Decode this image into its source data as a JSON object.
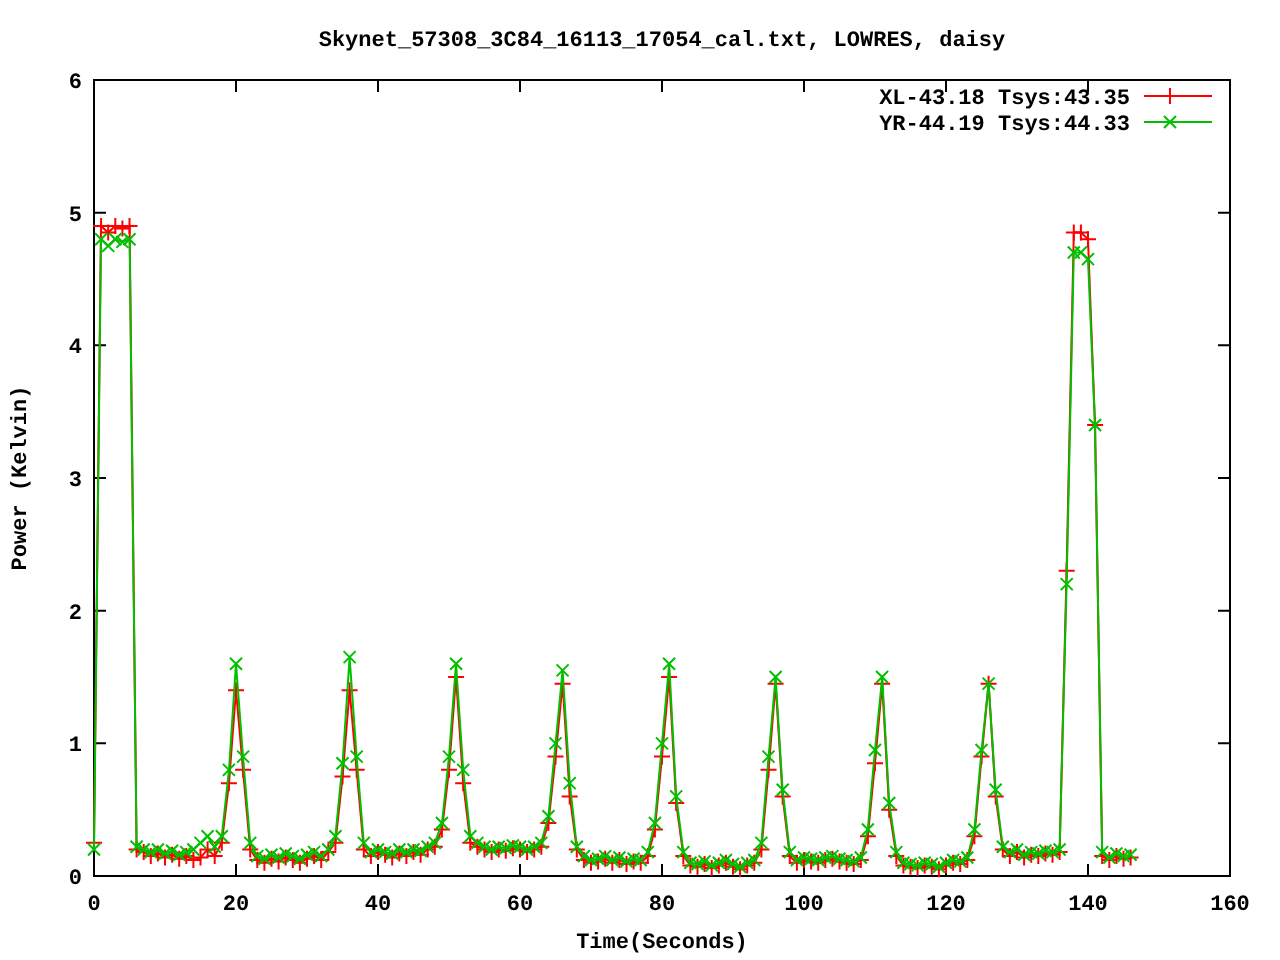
{
  "chart_data": {
    "type": "line",
    "title": "Skynet_57308_3C84_16113_17054_cal.txt, LOWRES, daisy",
    "xlabel": "Time(Seconds)",
    "ylabel": "Power (Kelvin)",
    "xlim": [
      0,
      160
    ],
    "ylim": [
      0,
      6
    ],
    "xticks": [
      0,
      20,
      40,
      60,
      80,
      100,
      120,
      140,
      160
    ],
    "yticks": [
      0,
      1,
      2,
      3,
      4,
      5,
      6
    ],
    "legend": true,
    "x": [
      0,
      1,
      2,
      3,
      4,
      5,
      6,
      7,
      8,
      9,
      10,
      11,
      12,
      13,
      14,
      15,
      16,
      17,
      18,
      19,
      20,
      21,
      22,
      23,
      24,
      25,
      26,
      27,
      28,
      29,
      30,
      31,
      32,
      33,
      34,
      35,
      36,
      37,
      38,
      39,
      40,
      41,
      42,
      43,
      44,
      45,
      46,
      47,
      48,
      49,
      50,
      51,
      52,
      53,
      54,
      55,
      56,
      57,
      58,
      59,
      60,
      61,
      62,
      63,
      64,
      65,
      66,
      67,
      68,
      69,
      70,
      71,
      72,
      73,
      74,
      75,
      76,
      77,
      78,
      79,
      80,
      81,
      82,
      83,
      84,
      85,
      86,
      87,
      88,
      89,
      90,
      91,
      92,
      93,
      94,
      95,
      96,
      97,
      98,
      99,
      100,
      101,
      102,
      103,
      104,
      105,
      106,
      107,
      108,
      109,
      110,
      111,
      112,
      113,
      114,
      115,
      116,
      117,
      118,
      119,
      120,
      121,
      122,
      123,
      124,
      125,
      126,
      127,
      128,
      129,
      130,
      131,
      132,
      133,
      134,
      135,
      136,
      137,
      138,
      139,
      140,
      141,
      142,
      143,
      144,
      145,
      146
    ],
    "series": [
      {
        "name": "XL-43.18 Tsys:43.35",
        "color": "#ff0000",
        "marker": "plus",
        "values": [
          0.25,
          4.9,
          4.85,
          4.9,
          4.88,
          4.9,
          0.2,
          0.18,
          0.15,
          0.17,
          0.14,
          0.16,
          0.13,
          0.15,
          0.12,
          0.14,
          0.2,
          0.15,
          0.25,
          0.7,
          1.4,
          0.8,
          0.2,
          0.12,
          0.1,
          0.13,
          0.11,
          0.14,
          0.12,
          0.1,
          0.13,
          0.15,
          0.12,
          0.18,
          0.25,
          0.75,
          1.4,
          0.8,
          0.2,
          0.15,
          0.18,
          0.16,
          0.14,
          0.17,
          0.15,
          0.18,
          0.16,
          0.2,
          0.22,
          0.35,
          0.8,
          1.5,
          0.7,
          0.25,
          0.22,
          0.2,
          0.18,
          0.2,
          0.19,
          0.21,
          0.2,
          0.18,
          0.2,
          0.22,
          0.4,
          0.9,
          1.45,
          0.6,
          0.2,
          0.12,
          0.1,
          0.11,
          0.13,
          0.1,
          0.12,
          0.09,
          0.11,
          0.1,
          0.15,
          0.35,
          0.9,
          1.5,
          0.55,
          0.15,
          0.08,
          0.07,
          0.09,
          0.06,
          0.08,
          0.1,
          0.07,
          0.05,
          0.08,
          0.1,
          0.2,
          0.8,
          1.45,
          0.6,
          0.15,
          0.1,
          0.12,
          0.11,
          0.1,
          0.12,
          0.13,
          0.11,
          0.1,
          0.09,
          0.12,
          0.3,
          0.85,
          1.45,
          0.5,
          0.15,
          0.08,
          0.07,
          0.06,
          0.08,
          0.07,
          0.05,
          0.08,
          0.1,
          0.09,
          0.12,
          0.3,
          0.9,
          1.45,
          0.6,
          0.2,
          0.15,
          0.18,
          0.14,
          0.16,
          0.15,
          0.17,
          0.16,
          0.18,
          2.3,
          4.85,
          4.85,
          4.8,
          3.4,
          0.15,
          0.12,
          0.15,
          0.13,
          0.14
        ]
      },
      {
        "name": "YR-44.19 Tsys:44.33",
        "color": "#00c000",
        "marker": "cross",
        "values": [
          0.2,
          4.8,
          4.75,
          4.8,
          4.78,
          4.8,
          0.22,
          0.2,
          0.18,
          0.2,
          0.17,
          0.19,
          0.16,
          0.18,
          0.2,
          0.25,
          0.3,
          0.22,
          0.3,
          0.8,
          1.6,
          0.9,
          0.25,
          0.15,
          0.13,
          0.16,
          0.14,
          0.17,
          0.15,
          0.13,
          0.16,
          0.18,
          0.15,
          0.2,
          0.3,
          0.85,
          1.65,
          0.9,
          0.25,
          0.18,
          0.2,
          0.18,
          0.17,
          0.2,
          0.18,
          0.2,
          0.19,
          0.22,
          0.25,
          0.4,
          0.9,
          1.6,
          0.8,
          0.3,
          0.25,
          0.22,
          0.2,
          0.22,
          0.21,
          0.23,
          0.22,
          0.2,
          0.22,
          0.25,
          0.45,
          1.0,
          1.55,
          0.7,
          0.22,
          0.15,
          0.12,
          0.13,
          0.15,
          0.12,
          0.14,
          0.11,
          0.13,
          0.12,
          0.18,
          0.4,
          1.0,
          1.6,
          0.6,
          0.18,
          0.1,
          0.09,
          0.11,
          0.08,
          0.1,
          0.12,
          0.09,
          0.07,
          0.1,
          0.12,
          0.25,
          0.9,
          1.5,
          0.65,
          0.18,
          0.12,
          0.14,
          0.13,
          0.12,
          0.14,
          0.15,
          0.13,
          0.12,
          0.11,
          0.14,
          0.35,
          0.95,
          1.5,
          0.55,
          0.18,
          0.1,
          0.09,
          0.08,
          0.1,
          0.09,
          0.07,
          0.1,
          0.12,
          0.11,
          0.14,
          0.35,
          0.95,
          1.45,
          0.65,
          0.22,
          0.18,
          0.2,
          0.16,
          0.18,
          0.17,
          0.19,
          0.18,
          0.2,
          2.2,
          4.7,
          4.7,
          4.65,
          3.4,
          0.18,
          0.14,
          0.17,
          0.15,
          0.16
        ]
      }
    ]
  }
}
